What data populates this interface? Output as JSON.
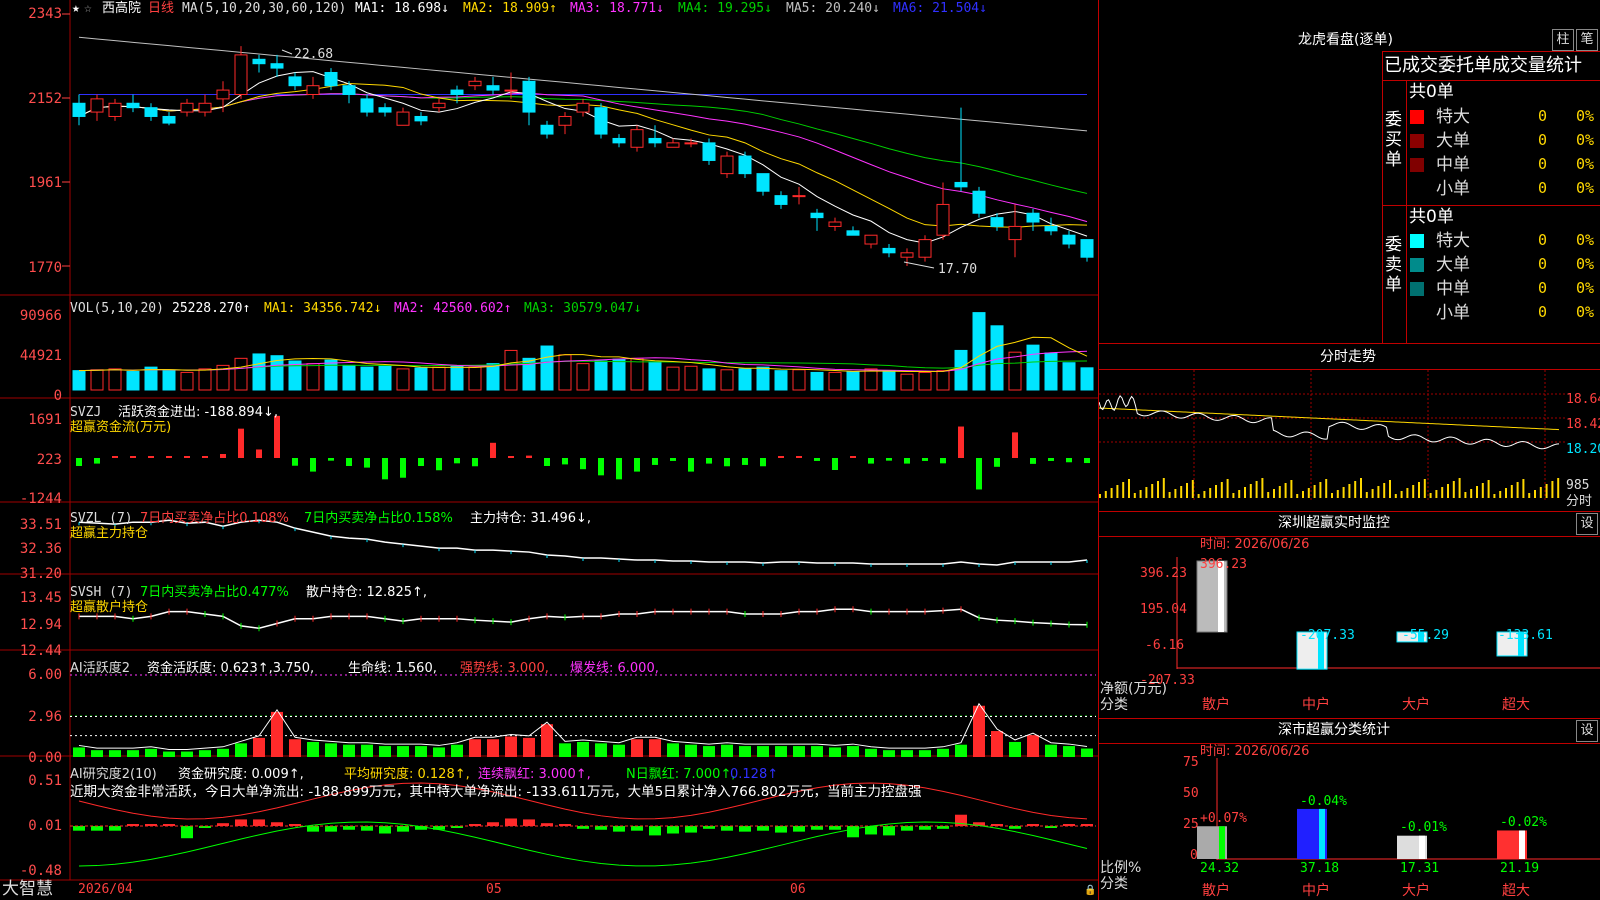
{
  "colors": {
    "up": "#ff2a2a",
    "down": "#00e5ff",
    "grid": "#a00000",
    "ma1": "#ffffff",
    "ma2": "#ffd800",
    "ma3": "#ff33ff",
    "ma4": "#00d000",
    "ma5": "#c0c0c0",
    "ma6": "#3030ff",
    "green": "#00ff00"
  },
  "header": {
    "stock": "西高院",
    "period": "日线",
    "ma_label": "MA(5,10,20,30,60,120)",
    "ma1": "MA1: 18.698↓",
    "ma2": "MA2: 18.909↑",
    "ma3": "MA3: 18.771↓",
    "ma4": "MA4: 19.295↓",
    "ma5": "MA5: 20.240↓",
    "ma6": "MA6: 21.504↓"
  },
  "price_axis": [
    "2343",
    "2152",
    "1961",
    "1770"
  ],
  "price_marks": {
    "high": "22.68",
    "low": "17.70"
  },
  "vol": {
    "title": "VOL(5,10,20)",
    "value": "25228.270↑",
    "ma1": "MA1: 34356.742↓",
    "ma2": "MA2: 42560.602↑",
    "ma3": "MA3: 30579.047↓",
    "axis": [
      "90966",
      "44921",
      "0"
    ]
  },
  "svzj": {
    "title": "SVZJ",
    "line1": "活跃资金进出: -188.894↓,",
    "line2": "超赢资金流(万元)",
    "axis": [
      "1691",
      "223",
      "-1244"
    ]
  },
  "svzl": {
    "title": "SVZL (7)",
    "a": "7日内买卖净占比0.108%",
    "b": "7日内买卖净占比0.158%",
    "c": "主力持仓: 31.496↓,",
    "line2": "超赢主力持仓",
    "axis": [
      "33.51",
      "32.36",
      "31.20"
    ]
  },
  "svsh": {
    "title": "SVSH (7)",
    "a": "7日内买卖净占比0.477%",
    "c": "散户持仓: 12.825↑,",
    "line2": "超赢散户持仓",
    "axis": [
      "13.45",
      "12.94",
      "12.44"
    ]
  },
  "ai1": {
    "title": "AI活跃度2",
    "a": "资金活跃度: 0.623↑,3.750,",
    "b": "生命线: 1.560,",
    "c": "强势线: 3.000,",
    "d": "爆发线: 6.000,",
    "axis": [
      "6.00",
      "2.96",
      "0.00"
    ]
  },
  "ai2": {
    "title": "AI研究度2(10)",
    "a": "资金研究度: 0.009↑,",
    "b": "平均研究度: 0.128↑,",
    "c": "连续飘红: 3.000↑,",
    "d": "N日飘红: 7.000↑,",
    "e": "0.128↑",
    "note": "近期大资金非常活跃，今日大单净流出: -188.899万元，其中特大单净流出: -133.611万元，大单5日累计净入766.802万元，当前主力控盘强",
    "axis": [
      "0.51",
      "0.01",
      "-0.48"
    ]
  },
  "date_axis": {
    "brand": "大智慧",
    "d1": "2026/04",
    "d2": "05",
    "d3": "06"
  },
  "dragon": {
    "title": "龙虎看盘(逐单)",
    "btn1": "柱",
    "btn2": "笔",
    "subtitle": "已成交委托单成交量统计",
    "buy_label": "委买单",
    "sell_label": "委卖单",
    "buy_total": "共0单",
    "sell_total": "共0单",
    "rows": [
      {
        "name": "特大",
        "n": "0",
        "p": "0%"
      },
      {
        "name": "大单",
        "n": "0",
        "p": "0%"
      },
      {
        "name": "中单",
        "n": "0",
        "p": "0%"
      },
      {
        "name": "小单",
        "n": "0",
        "p": "0%"
      }
    ]
  },
  "fenshi": {
    "title": "分时走势",
    "axis": [
      "18.64",
      "18.42",
      "18.20"
    ],
    "vol": "985",
    "vol_label": "分时"
  },
  "sz_monitor": {
    "title": "深圳超赢实时监控",
    "btn": "设",
    "time": "时间: 2026/06/26",
    "axis": [
      "396.23",
      "195.04",
      "-6.16",
      "-207.33"
    ],
    "ylabel": "净额(万元)",
    "xlabel": "分类",
    "cats": [
      "散户",
      "中户",
      "大户",
      "超大"
    ],
    "values": [
      396.23,
      -207.33,
      -55.29,
      -133.61
    ],
    "labels": [
      "396.23",
      "-207.33",
      "-55.29",
      "-133.61"
    ]
  },
  "sz_class": {
    "title": "深市超赢分类统计",
    "btn": "设",
    "time": "时间: 2026/06/26",
    "axis": [
      "75",
      "50",
      "25",
      "0"
    ],
    "ylabel": "比例%",
    "xlabel": "分类",
    "cats": [
      "散户",
      "中户",
      "大户",
      "超大"
    ],
    "values": [
      24.32,
      37.18,
      17.31,
      21.19
    ],
    "labels": [
      "24.32",
      "37.18",
      "17.31",
      "21.19"
    ],
    "chg": [
      "+0.07%",
      "-0.04%",
      "-0.01%",
      "-0.02%"
    ]
  },
  "chart_data": [
    {
      "type": "candlestick",
      "title": "西高院 日线",
      "ylim": [
        17.7,
        23.43
      ],
      "candles": [
        [
          21.4,
          21.1,
          21.6,
          20.9
        ],
        [
          21.2,
          21.5,
          21.6,
          21.0
        ],
        [
          21.1,
          21.4,
          21.5,
          21.0
        ],
        [
          21.4,
          21.3,
          21.6,
          21.2
        ],
        [
          21.3,
          21.1,
          21.4,
          21.0
        ],
        [
          21.1,
          20.95,
          21.2,
          20.9
        ],
        [
          21.2,
          21.4,
          21.5,
          21.1
        ],
        [
          21.2,
          21.4,
          21.6,
          21.1
        ],
        [
          21.5,
          21.7,
          21.9,
          21.2
        ],
        [
          21.6,
          22.5,
          22.7,
          21.5
        ],
        [
          22.4,
          22.3,
          22.5,
          22.1
        ],
        [
          22.3,
          22.2,
          22.5,
          22.0
        ],
        [
          22.0,
          21.8,
          22.1,
          21.7
        ],
        [
          21.6,
          21.8,
          22.0,
          21.5
        ],
        [
          22.1,
          21.8,
          22.2,
          21.7
        ],
        [
          21.8,
          21.6,
          21.9,
          21.4
        ],
        [
          21.5,
          21.2,
          21.6,
          21.1
        ],
        [
          21.3,
          21.2,
          21.4,
          21.1
        ],
        [
          20.9,
          21.2,
          21.3,
          20.9
        ],
        [
          21.1,
          21.0,
          21.2,
          20.9
        ],
        [
          21.3,
          21.4,
          21.5,
          21.2
        ],
        [
          21.7,
          21.6,
          21.8,
          21.4
        ],
        [
          21.8,
          21.9,
          22.0,
          21.7
        ],
        [
          21.8,
          21.7,
          22.0,
          21.6
        ],
        [
          21.7,
          21.7,
          22.1,
          21.5
        ],
        [
          21.9,
          21.2,
          22.0,
          20.9
        ],
        [
          20.9,
          20.7,
          21.0,
          20.6
        ],
        [
          20.9,
          21.1,
          21.2,
          20.7
        ],
        [
          21.2,
          21.4,
          21.5,
          21.1
        ],
        [
          21.3,
          20.7,
          21.4,
          20.6
        ],
        [
          20.6,
          20.5,
          20.7,
          20.4
        ],
        [
          20.4,
          20.8,
          20.9,
          20.3
        ],
        [
          20.6,
          20.5,
          20.9,
          20.4
        ],
        [
          20.4,
          20.5,
          20.6,
          20.4
        ],
        [
          20.5,
          20.5,
          20.6,
          20.4
        ],
        [
          20.5,
          20.1,
          20.6,
          20.0
        ],
        [
          19.8,
          20.2,
          20.3,
          19.7
        ],
        [
          20.2,
          19.8,
          20.3,
          19.7
        ],
        [
          19.8,
          19.4,
          19.8,
          19.3
        ],
        [
          19.3,
          19.1,
          19.4,
          19.0
        ],
        [
          19.3,
          19.3,
          19.5,
          19.1
        ],
        [
          18.9,
          18.8,
          19.0,
          18.5
        ],
        [
          18.6,
          18.7,
          18.8,
          18.5
        ],
        [
          18.5,
          18.4,
          18.6,
          18.4
        ],
        [
          18.2,
          18.4,
          18.4,
          18.1
        ],
        [
          18.1,
          18.0,
          18.2,
          17.9
        ],
        [
          17.9,
          18.0,
          18.1,
          17.7
        ],
        [
          17.9,
          18.3,
          18.4,
          17.8
        ],
        [
          18.4,
          19.1,
          19.6,
          18.3
        ],
        [
          19.6,
          19.5,
          21.3,
          19.4
        ],
        [
          19.4,
          18.9,
          19.5,
          18.8
        ],
        [
          18.8,
          18.6,
          18.9,
          18.5
        ],
        [
          18.3,
          18.6,
          19.1,
          17.9
        ],
        [
          18.9,
          18.7,
          19.0,
          18.5
        ],
        [
          18.6,
          18.5,
          18.8,
          18.4
        ],
        [
          18.4,
          18.2,
          18.5,
          18.1
        ],
        [
          18.3,
          17.9,
          18.3,
          17.8
        ]
      ]
    },
    {
      "type": "bar",
      "title": "VOL(5,10,20)",
      "ylim": [
        0,
        90966
      ],
      "values": [
        22000,
        23000,
        24000,
        21000,
        26000,
        22000,
        20000,
        24000,
        28000,
        36000,
        41000,
        39000,
        33000,
        30000,
        34000,
        28000,
        26000,
        27000,
        24000,
        25000,
        26000,
        27000,
        26000,
        30000,
        45000,
        36000,
        50000,
        40000,
        30000,
        33000,
        35000,
        36000,
        32000,
        26000,
        27000,
        24000,
        23000,
        24000,
        26000,
        22000,
        23000,
        20000,
        20000,
        21000,
        24000,
        22000,
        18000,
        20000,
        22000,
        45000,
        88000,
        73000,
        43000,
        51000,
        42000,
        31000,
        25228
      ]
    },
    {
      "type": "bar",
      "title": "超赢资金流(万元)",
      "ylim": [
        -1244,
        1691
      ],
      "values": [
        -300,
        -210,
        0,
        0,
        0,
        0,
        0,
        0,
        150,
        1100,
        320,
        1580,
        -290,
        -510,
        -100,
        -300,
        -360,
        -800,
        -740,
        -300,
        -460,
        -200,
        -310,
        570,
        10,
        90,
        -300,
        -240,
        -420,
        -650,
        -800,
        -510,
        -260,
        -110,
        -510,
        -210,
        -310,
        -260,
        -310,
        20,
        10,
        -110,
        -450,
        70,
        -210,
        -100,
        -210,
        -110,
        -200,
        1180,
        -1180,
        -330,
        960,
        -220,
        -110,
        -160,
        -189
      ]
    },
    {
      "type": "line",
      "title": "超赢主力持仓",
      "ylim": [
        31.2,
        33.51
      ],
      "values": [
        33.4,
        33.35,
        33.3,
        33.4,
        33.4,
        33.5,
        33.35,
        33.4,
        33.2,
        33.4,
        33.5,
        33.4,
        33.1,
        32.9,
        32.7,
        32.6,
        32.55,
        32.4,
        32.3,
        32.2,
        32.1,
        32.1,
        32.0,
        32.0,
        31.95,
        31.9,
        31.75,
        31.7,
        31.6,
        31.6,
        31.55,
        31.5,
        31.5,
        31.45,
        31.45,
        31.4,
        31.4,
        31.4,
        31.35,
        31.4,
        31.4,
        31.35,
        31.35,
        31.35,
        31.3,
        31.3,
        31.3,
        31.3,
        31.3,
        31.4,
        31.3,
        31.25,
        31.4,
        31.4,
        31.4,
        31.4,
        31.5
      ]
    },
    {
      "type": "line",
      "title": "超赢散户持仓",
      "ylim": [
        12.44,
        13.45
      ],
      "values": [
        13.0,
        13.0,
        13.0,
        12.95,
        13.0,
        13.1,
        13.1,
        13.05,
        13.0,
        12.8,
        12.75,
        12.85,
        12.95,
        12.95,
        13.0,
        13.0,
        13.0,
        12.95,
        12.9,
        12.95,
        12.95,
        12.95,
        12.92,
        12.9,
        12.88,
        12.95,
        13.0,
        12.98,
        13.0,
        13.0,
        13.05,
        13.05,
        13.1,
        13.1,
        13.1,
        13.1,
        13.1,
        13.05,
        13.05,
        13.05,
        13.1,
        13.1,
        13.15,
        13.15,
        13.1,
        13.1,
        13.1,
        13.1,
        13.12,
        13.15,
        12.97,
        12.92,
        12.9,
        12.87,
        12.85,
        12.83,
        12.825
      ]
    },
    {
      "type": "bar",
      "title": "AI活跃度2",
      "ylim": [
        0,
        6
      ],
      "values": [
        0.7,
        0.5,
        0.5,
        0.5,
        0.6,
        0.4,
        0.4,
        0.5,
        0.6,
        1.0,
        1.4,
        3.3,
        1.3,
        1.1,
        1.0,
        0.9,
        0.9,
        0.8,
        0.8,
        0.8,
        0.7,
        0.9,
        1.3,
        1.3,
        1.5,
        1.4,
        2.4,
        1.0,
        1.1,
        1.0,
        0.9,
        1.3,
        1.3,
        1.0,
        0.9,
        0.8,
        0.9,
        0.8,
        0.8,
        0.8,
        0.8,
        0.8,
        0.7,
        0.8,
        0.6,
        0.5,
        0.5,
        0.5,
        0.6,
        0.9,
        3.75,
        1.9,
        1.1,
        1.6,
        0.9,
        0.8,
        0.62
      ]
    },
    {
      "type": "bar",
      "title": "AI研究度2(10)",
      "ylim": [
        -0.48,
        0.51
      ],
      "values": [
        -0.05,
        -0.05,
        -0.05,
        0.0,
        0.0,
        0.02,
        -0.13,
        -0.02,
        0.03,
        0.07,
        0.07,
        0.04,
        0.02,
        -0.06,
        -0.06,
        -0.04,
        -0.05,
        -0.08,
        -0.06,
        -0.04,
        -0.04,
        -0.02,
        0.02,
        0.04,
        0.08,
        0.07,
        0.03,
        0.01,
        -0.03,
        -0.04,
        -0.06,
        -0.05,
        -0.1,
        -0.08,
        -0.07,
        -0.03,
        -0.05,
        -0.06,
        -0.05,
        -0.07,
        -0.06,
        -0.04,
        -0.04,
        -0.12,
        -0.09,
        -0.1,
        -0.05,
        -0.04,
        -0.03,
        0.12,
        0.04,
        0.02,
        -0.03,
        0.01,
        -0.02,
        0.0,
        0.009
      ]
    }
  ]
}
